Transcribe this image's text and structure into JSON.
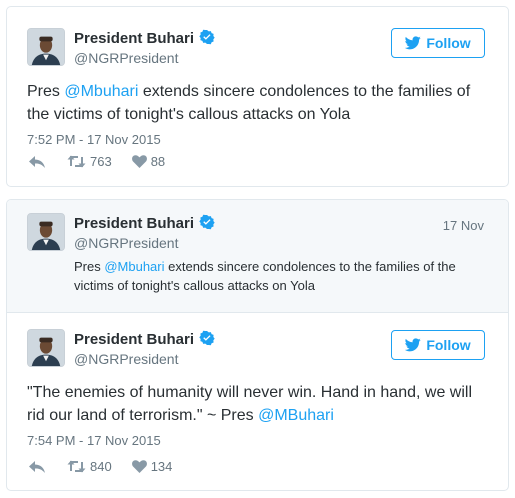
{
  "tweet1": {
    "name": "President Buhari",
    "handle": "@NGRPresident",
    "follow_label": "Follow",
    "text_line1_pre": "Pres ",
    "text_line1_mention": "@Mbuhari",
    "text_line1_post": " extends sincere condolences to the families of",
    "text_line2": "the victims of tonight's callous attacks on Yola",
    "timestamp": "7:52 PM - 17 Nov 2015",
    "retweets": "763",
    "likes": "88"
  },
  "quoted": {
    "name": "President Buhari",
    "handle": "@NGRPresident",
    "date": "17 Nov",
    "text_line1_pre": "Pres ",
    "text_line1_mention": "@Mbuhari",
    "text_line1_post": " extends sincere condolences to the families of the",
    "text_line2": "victims of tonight's callous attacks on Yola"
  },
  "tweet2": {
    "name": "President Buhari",
    "handle": "@NGRPresident",
    "follow_label": "Follow",
    "text_line1": "\"The enemies of humanity will never win. Hand in hand, we will",
    "text_line2_pre": "rid our land of terrorism.\" ~ Pres ",
    "text_line2_mention": "@MBuhari",
    "timestamp": "7:54 PM - 17 Nov 2015",
    "retweets": "840",
    "likes": "134"
  },
  "colors": {
    "accent": "#1da1f2",
    "text": "#292f33",
    "secondary": "#66757f",
    "border": "#e1e8ed",
    "quoted_bg": "#f5f8fa"
  },
  "icons": [
    "avatar",
    "verified-badge-icon",
    "twitter-bird-icon",
    "reply-icon",
    "retweet-icon",
    "heart-icon"
  ]
}
